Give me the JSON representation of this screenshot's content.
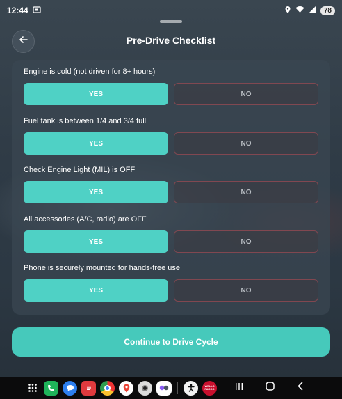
{
  "status_bar": {
    "time": "12:44",
    "battery": "78",
    "icons": [
      "screenshot-icon",
      "location-icon",
      "wifi-icon",
      "signal-icon"
    ]
  },
  "header": {
    "title": "Pre-Drive Checklist",
    "back_icon": "arrow-left-icon"
  },
  "checklist": [
    {
      "question": "Engine is cold (not driven for 8+ hours)",
      "yes": "YES",
      "no": "NO",
      "selected": "yes"
    },
    {
      "question": "Fuel tank is between 1/4 and 3/4 full",
      "yes": "YES",
      "no": "NO",
      "selected": "yes"
    },
    {
      "question": "Check Engine Light (MIL) is OFF",
      "yes": "YES",
      "no": "NO",
      "selected": "yes"
    },
    {
      "question": "All accessories (A/C, radio) are OFF",
      "yes": "YES",
      "no": "NO",
      "selected": "yes"
    },
    {
      "question": "Phone is securely mounted for hands-free use",
      "yes": "YES",
      "no": "NO",
      "selected": "yes"
    }
  ],
  "continue_label": "Continue to Drive Cycle",
  "colors": {
    "accent": "#4fd1c5",
    "no_border": "#be505a"
  },
  "nav_bar": {
    "apps": [
      "apps-grid-icon",
      "phone-icon",
      "messages-icon",
      "notes-icon",
      "chrome-icon",
      "maps-icon",
      "camera-icon",
      "gallery-icon",
      "accessibility-icon",
      "wells-fargo-icon"
    ],
    "wells_fargo_text": "WELLS FARGO"
  }
}
